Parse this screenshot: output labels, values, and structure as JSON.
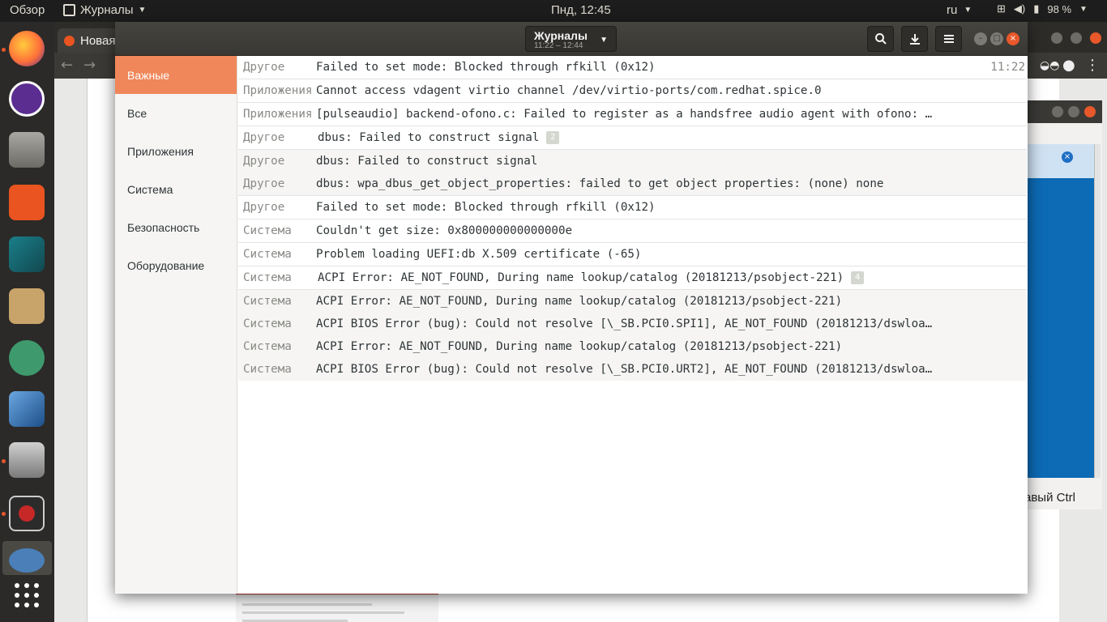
{
  "topbar": {
    "activities": "Обзор",
    "app_name": "Журналы",
    "clock": "Пнд, 12:45",
    "lang": "ru",
    "battery": "98 %"
  },
  "browser": {
    "tab_label": "Новая"
  },
  "vm_window": {
    "ctrl_text": "авый Ctrl"
  },
  "logs": {
    "title": "Журналы",
    "subtitle": "11:22 – 12:44",
    "sidebar": [
      {
        "label": "Важные"
      },
      {
        "label": "Все"
      },
      {
        "label": "Приложения"
      },
      {
        "label": "Система"
      },
      {
        "label": "Безопасность"
      },
      {
        "label": "Оборудование"
      }
    ],
    "rows": [
      {
        "cat": "Другое",
        "msg": "Failed to set mode: Blocked through rfkill (0x12)",
        "time": "11:22"
      },
      {
        "cat": "Приложения",
        "msg": "Cannot access vdagent virtio channel /dev/virtio-ports/com.redhat.spice.0"
      },
      {
        "cat": "Приложения",
        "msg": "[pulseaudio] backend-ofono.c: Failed to register as a handsfree audio agent with ofono: …"
      },
      {
        "cat": "Другое",
        "msg": "dbus: Failed to construct signal",
        "badge": "2"
      },
      {
        "cat": "Другое",
        "msg": "dbus: Failed to construct signal"
      },
      {
        "cat": "Другое",
        "msg": "dbus: wpa_dbus_get_object_properties: failed to get object properties: (none) none"
      },
      {
        "cat": "Другое",
        "msg": "Failed to set mode: Blocked through rfkill (0x12)"
      },
      {
        "cat": "Система",
        "msg": "Couldn't get size: 0x800000000000000e"
      },
      {
        "cat": "Система",
        "msg": "Problem loading UEFI:db X.509 certificate (-65)"
      },
      {
        "cat": "Система",
        "msg": "ACPI Error: AE_NOT_FOUND, During name lookup/catalog (20181213/psobject-221)",
        "badge": "4"
      },
      {
        "cat": "Система",
        "msg": "ACPI Error: AE_NOT_FOUND, During name lookup/catalog (20181213/psobject-221)"
      },
      {
        "cat": "Система",
        "msg": "ACPI BIOS Error (bug): Could not resolve [\\_SB.PCI0.SPI1], AE_NOT_FOUND (20181213/dswloa…"
      },
      {
        "cat": "Система",
        "msg": "ACPI Error: AE_NOT_FOUND, During name lookup/catalog (20181213/psobject-221)"
      },
      {
        "cat": "Система",
        "msg": "ACPI BIOS Error (bug): Could not resolve [\\_SB.PCI0.URT2], AE_NOT_FOUND (20181213/dswloa…"
      }
    ]
  },
  "colors": {
    "accent": "#f0875a",
    "close": "#e8582a",
    "header": "#3f3e3a"
  },
  "dock_icons": [
    "firefox-icon",
    "rhythmbox-icon",
    "files-icon",
    "software-center-icon",
    "store-bag-icon",
    "archive-manager-icon",
    "atom-icon",
    "virtualbox-icon",
    "installer-icon",
    "blocked-app-icon",
    "screenshot-icon",
    "show-apps-icon"
  ]
}
